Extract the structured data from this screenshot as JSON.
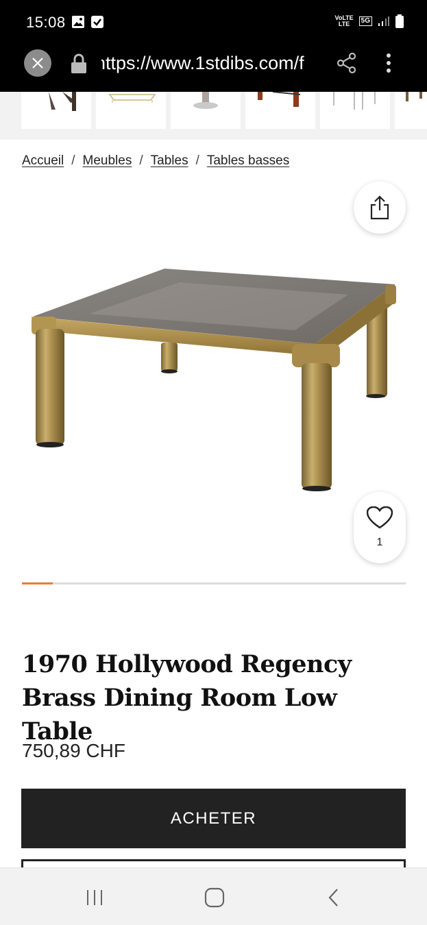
{
  "status_bar": {
    "time": "15:08",
    "icons": [
      "gallery-notification-icon",
      "check-notification-icon"
    ],
    "network": "VoLTE",
    "network_line2": "LTE",
    "network_type": "5G"
  },
  "browser": {
    "url": "https://www.1stdibs.com/f",
    "icons": [
      "close-icon",
      "lock-icon",
      "share-icon",
      "more-vert-icon"
    ]
  },
  "thumbnails": {
    "count_visible": 6
  },
  "breadcrumb": {
    "items": [
      "Accueil",
      "Meubles",
      "Tables",
      "Tables basses"
    ],
    "separator": "/"
  },
  "gallery": {
    "image_subject": "brass coffee table with smoked glass top",
    "favorite_count": "1",
    "progress": 0.08
  },
  "product": {
    "title": "1970 Hollywood Regency Brass Dining Room Low Table",
    "price": "750,89 CHF",
    "buy_label": "ACHETER"
  },
  "colors": {
    "accent": "#f07c2a",
    "button_dark": "#222222",
    "brass": "#b89c5a"
  },
  "nav_bar": {
    "icons": [
      "recent-apps-icon",
      "home-icon",
      "back-icon"
    ]
  }
}
